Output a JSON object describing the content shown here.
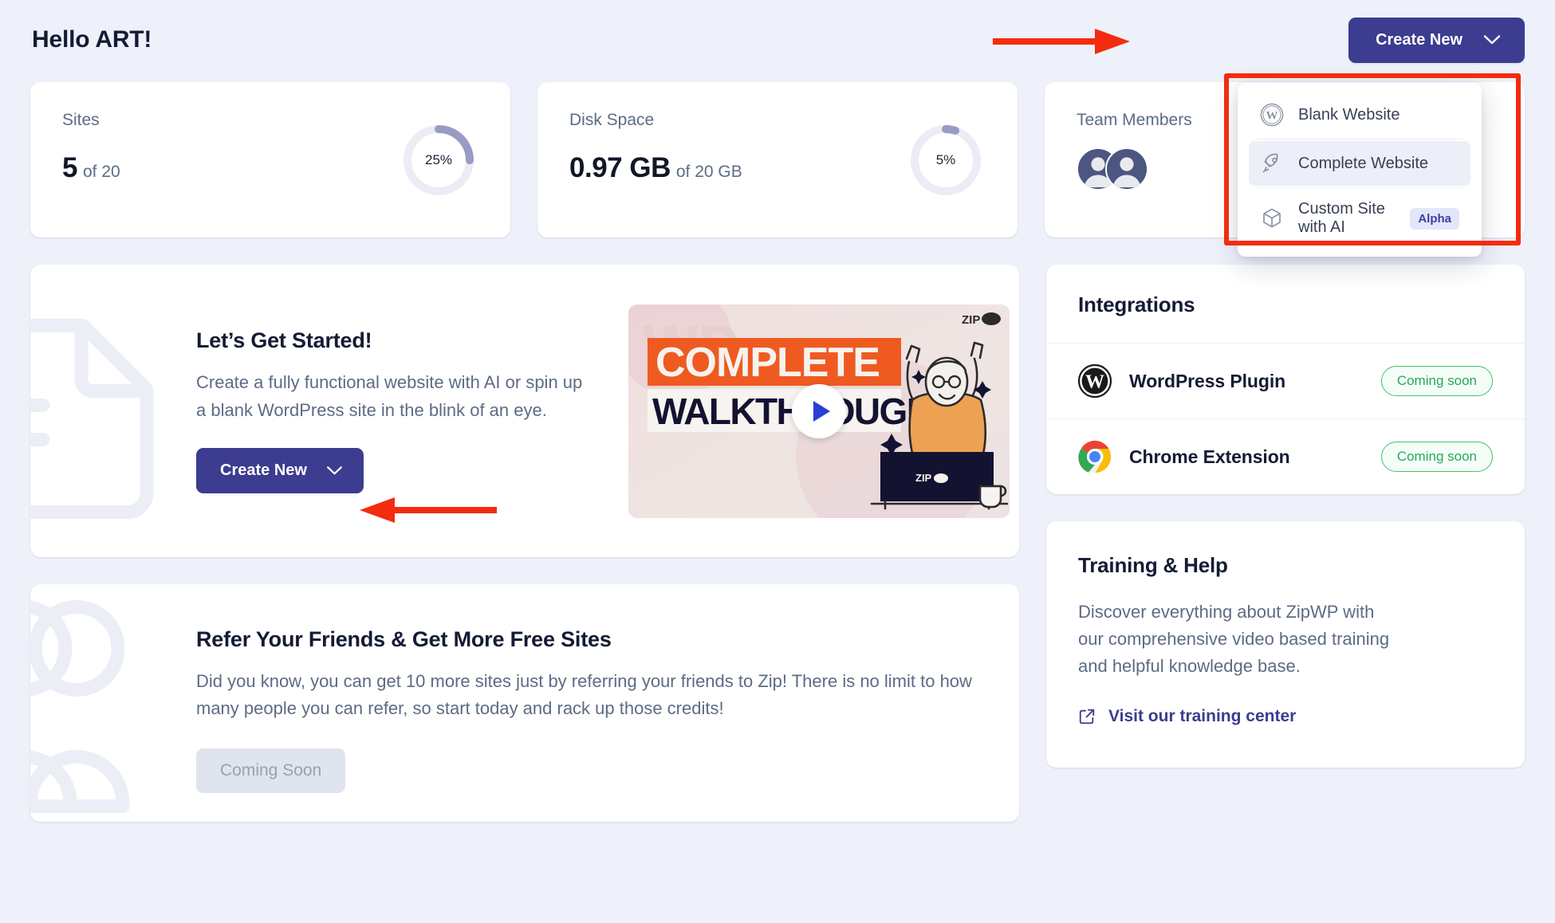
{
  "header": {
    "greeting": "Hello ART!",
    "create_button_label": "Create New"
  },
  "create_menu": {
    "items": [
      {
        "label": "Blank Website",
        "icon": "wordpress-icon",
        "badge": null,
        "active": false
      },
      {
        "label": "Complete Website",
        "icon": "rocket-icon",
        "badge": null,
        "active": true
      },
      {
        "label": "Custom Site with AI",
        "icon": "cube-icon",
        "badge": "Alpha",
        "active": false
      }
    ]
  },
  "stats": [
    {
      "label": "Sites",
      "value": "5",
      "suffix": "of 20",
      "percent_text": "25%",
      "percent": 25,
      "type": "donut"
    },
    {
      "label": "Disk Space",
      "value": "0.97 GB",
      "suffix": "of 20 GB",
      "percent_text": "5%",
      "percent": 5,
      "type": "donut"
    },
    {
      "label": "Team Members",
      "type": "avatars",
      "avatar_count": 2
    }
  ],
  "get_started": {
    "title": "Let’s Get Started!",
    "body": "Create a fully functional website with AI or spin up a blank WordPress site in the blink of an eye.",
    "button_label": "Create New",
    "video": {
      "line1": "COMPLETE",
      "line2": "WALKTHROUGH",
      "brand": "ZIP",
      "laptop_brand": "ZIP"
    }
  },
  "refer": {
    "title": "Refer Your Friends & Get More Free Sites",
    "body": "Did you know, you can get 10 more sites just by referring your friends to Zip! There is no limit to how many people you can refer, so start today and rack up those credits!",
    "button_label": "Coming Soon"
  },
  "integrations": {
    "title": "Integrations",
    "rows": [
      {
        "name": "WordPress Plugin",
        "icon": "wordpress-icon",
        "status": "Coming soon"
      },
      {
        "name": "Chrome Extension",
        "icon": "chrome-icon",
        "status": "Coming soon"
      }
    ]
  },
  "training": {
    "title": "Training & Help",
    "body": "Discover everything about ZipWP with our comprehensive video based training and helpful knowledge base.",
    "link_label": "Visit our training center"
  },
  "colors": {
    "page_bg": "#eef1fa",
    "accent_indigo": "#3c3c91",
    "annotation_red": "#f32c10",
    "donut_track": "#edebf5",
    "donut_fill": "#9a9bc4",
    "pill_green": "#3ec46d",
    "text_dark": "#141b34",
    "text_muted": "#5d6b84"
  }
}
